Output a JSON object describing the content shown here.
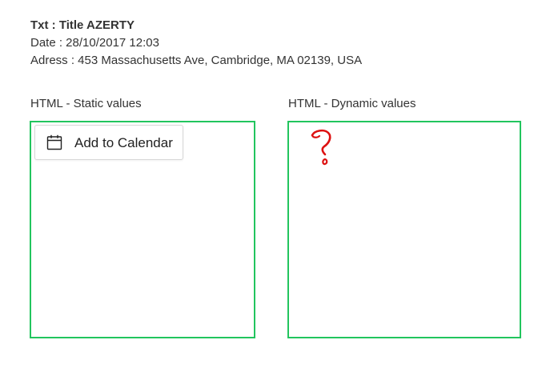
{
  "event": {
    "title_line": "Txt : Title AZERTY",
    "date_line": "Date : 28/10/2017 12:03",
    "address_line": "Adress : 453 Massachusetts Ave, Cambridge, MA 02139, USA"
  },
  "sections": {
    "static_label": "HTML - Static values",
    "dynamic_label": "HTML - Dynamic values"
  },
  "calendar_button": {
    "label": "Add to Calendar",
    "icon": "calendar-icon"
  },
  "annotation": {
    "icon": "question-mark-icon",
    "color": "#dd1111"
  },
  "colors": {
    "box_border": "#22c55e"
  }
}
